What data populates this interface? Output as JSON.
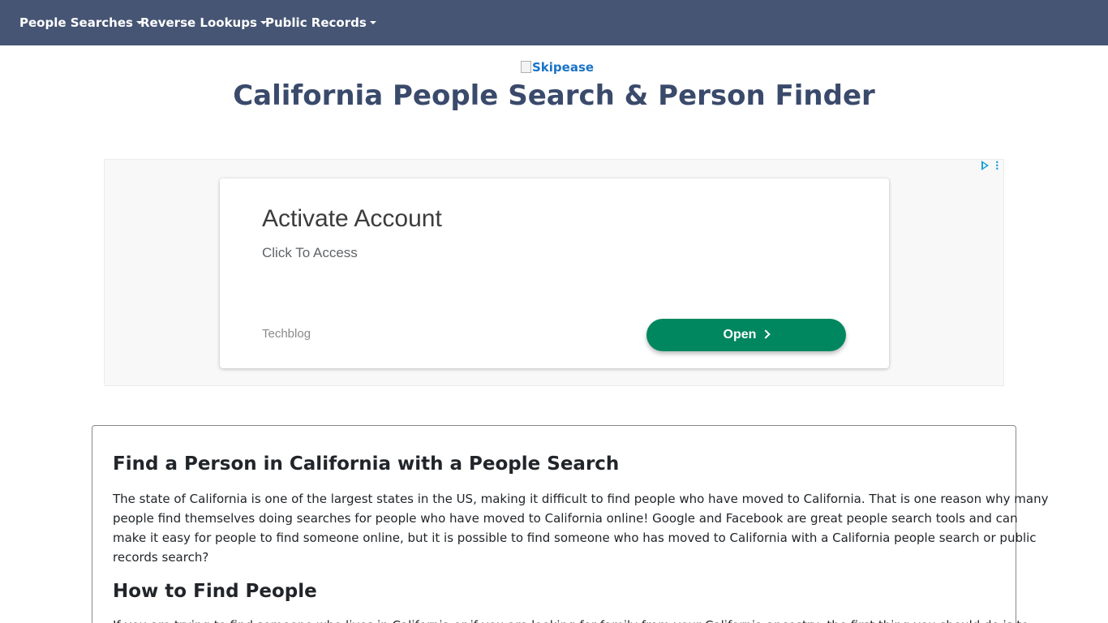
{
  "navbar": {
    "items": [
      {
        "label": "People Searches"
      },
      {
        "label": "Reverse Lookups"
      },
      {
        "label": "Public Records"
      }
    ]
  },
  "header": {
    "logo_alt": "Skipease",
    "title": "California People Search & Person Finder"
  },
  "ad": {
    "headline": "Activate Account",
    "description": "Click To Access",
    "advertiser": "Techblog",
    "button_label": "Open",
    "icons": [
      "adchoices-play-icon",
      "more-options-icon",
      "chevron-right-icon"
    ],
    "button_color": "#01875f"
  },
  "content": {
    "section1": {
      "heading": "Find a Person in California with a People Search",
      "lines": [
        "The state of California is one of the largest states in the US, making it difficult to find people who have moved to California. That is one reason why many",
        "people find themselves doing searches for people who have moved to California online! Google and Facebook are great people search tools and can",
        "make it easy for people to find someone online, but it is possible to find someone who has moved to California with a California people search or public",
        "records search?"
      ]
    },
    "section2": {
      "heading": "How to Find People",
      "lines": [
        "If you are trying to find someone who lives in California or if you are looking for family from your California ancestry, the first thing you should do is to"
      ]
    }
  },
  "colors": {
    "navbar_bg": "#465574",
    "title_color": "#3a4a6b",
    "link_color": "#1a73c8"
  }
}
